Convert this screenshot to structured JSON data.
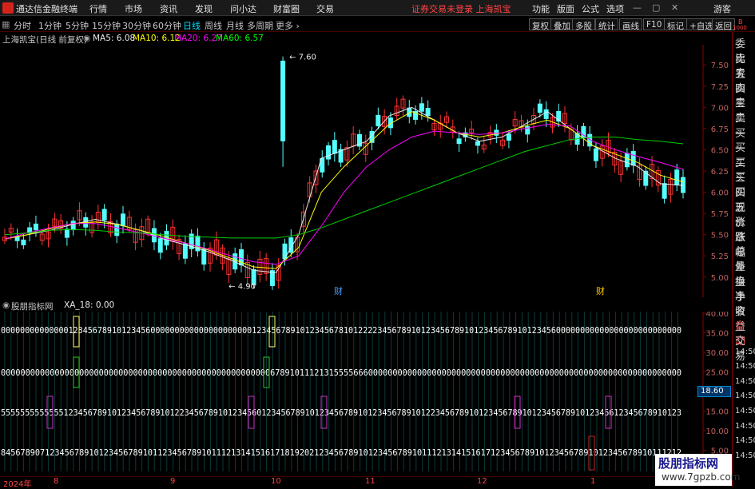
{
  "menubar": {
    "app_title": "通达信金融终端",
    "items": [
      "行情",
      "市场",
      "资讯",
      "发现",
      "问小达",
      "财富圈",
      "交易"
    ],
    "notice": "证券交易未登录  上海凯宝",
    "right_items": [
      "功能",
      "版面",
      "公式",
      "选项"
    ],
    "guest": "游客"
  },
  "periods": {
    "items": [
      "分时",
      "1分钟",
      "5分钟",
      "15分钟",
      "30分钟",
      "60分钟",
      "日线",
      "周线",
      "月线",
      "多周期",
      "更多 ›"
    ],
    "active": "日线"
  },
  "toolbar_buttons": [
    "复权",
    "叠加",
    "多股",
    "统计",
    "画线",
    "F10",
    "标记",
    "+自选",
    "返回"
  ],
  "info": {
    "stock": "上海凯宝(日线 前复权)",
    "ma5": "MA5: 6.08",
    "ma10": "MA10: 6.12",
    "ma20": "MA20: 6.27",
    "ma60": "MA60: 6.57"
  },
  "indicator": {
    "name": "股朋指标网",
    "value": "XA_18: 0.00",
    "side_value": "18.60"
  },
  "right_panel": [
    "委比",
    "卖五",
    "卖四",
    "卖三",
    "卖二",
    "卖一",
    "买一",
    "买二",
    "买三",
    "买四",
    "买五",
    "现价",
    "涨跌",
    "涨幅",
    "总量",
    "外盘",
    "换手",
    "净资",
    "收益",
    "自动",
    "交易",
    "14:50",
    "14:50",
    "14:50",
    "14:50",
    "14:50",
    "14:50",
    "14:50",
    "14:50"
  ],
  "price_axis": [
    "7.50",
    "7.25",
    "7.00",
    "6.75",
    "6.50",
    "6.25",
    "6.00",
    "5.75",
    "5.50",
    "5.25",
    "5.00"
  ],
  "indicator_axis": [
    "40.00",
    "35.00",
    "30.00",
    "25.00",
    "20.00",
    "15.00",
    "10.00",
    "5.00"
  ],
  "annotations": {
    "high": "7.60",
    "low": "4.90",
    "cai1": "财",
    "cai2": "财"
  },
  "time_axis": [
    "2024年",
    "8",
    "9",
    "10",
    "11",
    "12",
    "1"
  ],
  "watermark": {
    "line1": "股朋指标网",
    "line2": "www.7gpzb.com"
  },
  "top_right_small": [
    "B",
    "1000"
  ],
  "chart_data": {
    "type": "line",
    "series": [
      {
        "name": "MA5",
        "values": [
          5.45,
          5.5,
          5.55,
          5.62,
          5.68,
          5.62,
          5.55,
          5.45,
          5.38,
          5.3,
          5.2,
          5.08,
          5.05,
          5.5,
          6.4,
          6.5,
          6.6,
          6.9,
          7.0,
          6.85,
          6.7,
          6.6,
          6.65,
          6.8,
          6.95,
          6.75,
          6.55,
          6.4,
          6.3,
          6.1,
          6.08
        ]
      },
      {
        "name": "MA10",
        "values": [
          5.45,
          5.5,
          5.57,
          5.63,
          5.65,
          5.62,
          5.55,
          5.48,
          5.4,
          5.32,
          5.22,
          5.12,
          5.1,
          5.35,
          6.0,
          6.3,
          6.55,
          6.8,
          6.95,
          6.85,
          6.7,
          6.65,
          6.7,
          6.78,
          6.85,
          6.75,
          6.55,
          6.45,
          6.35,
          6.2,
          6.12
        ]
      },
      {
        "name": "MA20",
        "values": [
          5.45,
          5.52,
          5.58,
          5.63,
          5.63,
          5.58,
          5.52,
          5.46,
          5.4,
          5.33,
          5.25,
          5.18,
          5.15,
          5.25,
          5.6,
          6.0,
          6.3,
          6.5,
          6.65,
          6.72,
          6.7,
          6.68,
          6.7,
          6.75,
          6.8,
          6.78,
          6.6,
          6.5,
          6.42,
          6.35,
          6.27
        ]
      },
      {
        "name": "MA60",
        "values": [
          5.5,
          5.52,
          5.55,
          5.56,
          5.55,
          5.53,
          5.52,
          5.5,
          5.48,
          5.47,
          5.46,
          5.46,
          5.46,
          5.5,
          5.58,
          5.68,
          5.78,
          5.88,
          5.98,
          6.08,
          6.18,
          6.28,
          6.38,
          6.48,
          6.55,
          6.62,
          6.65,
          6.65,
          6.62,
          6.6,
          6.57
        ]
      }
    ],
    "ylim": [
      4.8,
      7.7
    ]
  }
}
